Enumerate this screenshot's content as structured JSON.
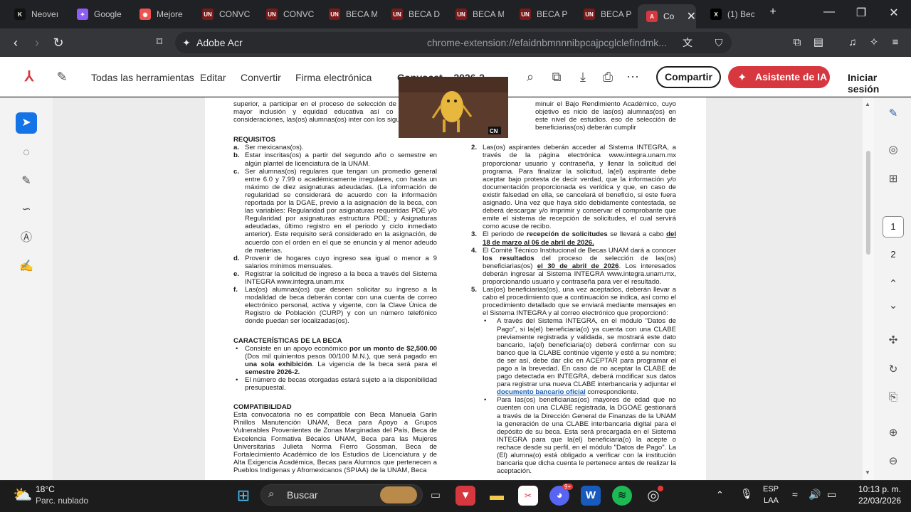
{
  "browser": {
    "tabs": [
      {
        "title": "Neoveı",
        "fav_color": "#111111",
        "fav_glyph": "K"
      },
      {
        "title": "Google",
        "fav_color": "#8e5cf7",
        "fav_glyph": "✦"
      },
      {
        "title": "Mejore",
        "fav_color": "#ef5350",
        "fav_glyph": "◉"
      },
      {
        "title": "CONVC",
        "fav_color": "#7a1b1b",
        "fav_glyph": "UN"
      },
      {
        "title": "CONVC",
        "fav_color": "#7a1b1b",
        "fav_glyph": "UN"
      },
      {
        "title": "BECA M",
        "fav_color": "#7a1b1b",
        "fav_glyph": "UN"
      },
      {
        "title": "BECA D",
        "fav_color": "#7a1b1b",
        "fav_glyph": "UN"
      },
      {
        "title": "BECA M",
        "fav_color": "#7a1b1b",
        "fav_glyph": "UN"
      },
      {
        "title": "BECA P",
        "fav_color": "#7a1b1b",
        "fav_glyph": "UN"
      },
      {
        "title": "BECA P",
        "fav_color": "#7a1b1b",
        "fav_glyph": "UN"
      },
      {
        "title": "Co",
        "fav_color": "#d7373f",
        "fav_glyph": "A",
        "active": true
      },
      {
        "title": "(1) Bec",
        "fav_color": "#000000",
        "fav_glyph": "X"
      }
    ],
    "site_label": "Adobe Acr",
    "url": "chrome-extension://efaidnbmnnnibpcajpcglclefindmk..."
  },
  "acrobat": {
    "menu": [
      "Todas las herramientas",
      "Editar",
      "Convertir",
      "Firma electrónica"
    ],
    "doc_title": "Convocat... 2026-2",
    "share": "Compartir",
    "ai_assistant": "Asistente de IA",
    "signin": "Iniciar sesión",
    "pages": [
      "1",
      "2"
    ]
  },
  "document": {
    "left_intro": "superior, a participar en el proceso de selección de be asegurar mayor inclusión y equidad educativa así co Bajo estas consideraciones, las(os) alumnas(os) inter con los siguientes.",
    "requisitos_title": "REQUISITOS",
    "requisitos": [
      {
        "m": "a.",
        "t": "Ser mexicanas(os)."
      },
      {
        "m": "b.",
        "t": "Estar inscritas(os) a partir del segundo año o semestre en algún plantel de licenciatura de la UNAM."
      },
      {
        "m": "c.",
        "t": "Ser alumnas(os) regulares que tengan un promedio general entre 6.0 y 7.99 o académicamente irregulares, con hasta un máximo de diez asignaturas adeudadas. (La información de regularidad se considerará de acuerdo con la información reportada por la DGAE, previo a la asignación de la beca, con las variables: Regularidad por asignaturas requeridas PDE y/o Regularidad por asignaturas estructura PDE; y Asignaturas adeudadas, último registro en el periodo y ciclo inmediato anterior). Este requisito será considerado en la asignación, de acuerdo con el orden en el que se enuncia y al menor adeudo de materias."
      },
      {
        "m": "d.",
        "t": "Provenir de hogares cuyo ingreso sea igual o menor a 9 salarios mínimos mensuales."
      },
      {
        "m": "e.",
        "t": "Registrar la solicitud de ingreso a la beca a través del Sistema INTEGRA www.integra.unam.mx"
      },
      {
        "m": "f.",
        "t": "Las(os) alumnas(os) que deseen solicitar su ingreso a la modalidad de beca deberán contar con una cuenta de correo electrónico personal, activa y vigente, con la Clave Única de Registro de Población (CURP) y con un número telefónico donde puedan ser localizadas(os)."
      }
    ],
    "caract_title": "CARACTERÍSTICAS DE LA BECA",
    "caract_1a": "Consiste en un apoyo económico ",
    "caract_1b": "por un monto de $2,500.00",
    "caract_1c": " (Dos mil quinientos pesos 00/100 M.N.), que será pagado en ",
    "caract_1d": "una sola exhibición",
    "caract_1e": ". La vigencia de la beca será para el ",
    "caract_1f": "semestre 2026-2.",
    "caract_2": "El número de becas otorgadas estará sujeto a la disponibilidad presupuestal.",
    "compat_title": "COMPATIBILIDAD",
    "compat": "Esta convocatoria no es compatible con Beca Manuela Garín Pinillos Manutención UNAM, Beca para Apoyo a Grupos Vulnerables Provenientes de Zonas Marginadas del País, Beca de Excelencia Formativa Bécalos UNAM, Beca para las Mujeres Universitarias Julieta Norma Fierro Gossman, Beca de Fortalecimiento Académico de los Estudios de Licenciatura y de Alta Exigencia Académica, Becas para Alumnos que pertenecen a Pueblos Indígenas y Afromexicanos (SPIAA) de la UNAM, Beca",
    "right_intro": "minuir el Bajo Rendimiento Académico, cuyo objetivo es nicio de las(os) alumnas(os) en este nivel de estudios. eso de selección de beneficiarias(os) deberán cumplir",
    "p2_m": "2.",
    "p2": "Las(os) aspirantes deberán acceder al Sistema INTEGRA, a través de la página electrónica www.integra.unam.mx proporcionar usuario y contraseña, y llenar la solicitud del programa. Para finalizar la solicitud, la(el) aspirante debe aceptar bajo protesta de decir verdad, que la información y/o documentación proporcionada es verídica y que, en caso de existir falsedad en ella, se cancelará el beneficio, si este fuera asignado. Una vez que haya sido debidamente contestada, se deberá descargar y/o imprimir y conservar el comprobante que emite el sistema de recepción de solicitudes, el cual servirá como acuse de recibo.",
    "p3_m": "3.",
    "p3a": "El periodo de ",
    "p3b": "recepción de solicitudes",
    "p3c": " se llevará a cabo ",
    "p3d": "del 18 de marzo al 06 de abril de 2026.",
    "p4_m": "4.",
    "p4a": "El Comité Técnico Institucional de Becas UNAM dará a conocer ",
    "p4b": "los resultados",
    "p4c": " del proceso de selección de las(os) beneficiarias(os) ",
    "p4d": "el 30 de abril de 2026",
    "p4e": ". Los interesados deberán ingresar al Sistema INTEGRA www.integra.unam.mx, proporcionando usuario y contraseña para ver el resultado.",
    "p5_m": "5.",
    "p5": "Las(os) beneficiarias(os), una vez aceptados, deberán llevar a cabo el procedimiento que a continuación se indica, así como el procedimiento detallado que se enviará mediante mensajes en el Sistema INTEGRA y al correo electrónico que proporcionó:",
    "s1a": "A través del Sistema INTEGRA, en el módulo \"Datos de Pago\", si la(el) beneficiaria(o) ya cuenta con una CLABE previamente registrada y validada, se mostrará este dato bancario, la(el) beneficiaria(o) deberá confirmar con su banco que la CLABE continúe vigente y esté a su nombre; de ser así, debe dar clic en ACEPTAR para programar el pago a la brevedad. En caso de no aceptar la CLABE de pago detectada en INTEGRA, deberá modificar sus datos para registrar una nueva CLABE interbancaria y adjuntar el ",
    "s1b": "documento bancario oficial",
    "s1c": " correspondiente.",
    "s2": "Para las(os) beneficiarias(os) mayores de edad que no cuenten con una CLABE registrada, la DGOAE gestionará a través de la Dirección General de Finanzas de la UNAM la generación de una CLABE interbancaria digital para el depósito de su beca. Esta será precargada en el Sistema INTEGRA para que la(el) beneficiaria(o) la acepte o rechace desde su perfil, en el módulo \"Datos de Pago\". La (El) alumna(o) está obligado a verificar con la institución bancaria que dicha cuenta le pertenece antes de realizar la aceptación."
  },
  "taskbar": {
    "weather_temp": "18°C",
    "weather_desc": "Parc. nublado",
    "search": "Buscar",
    "lang1": "ESP",
    "lang2": "LAA",
    "time": "10:13 p. m.",
    "date": "22/03/2026",
    "discord_badge": "9+"
  }
}
